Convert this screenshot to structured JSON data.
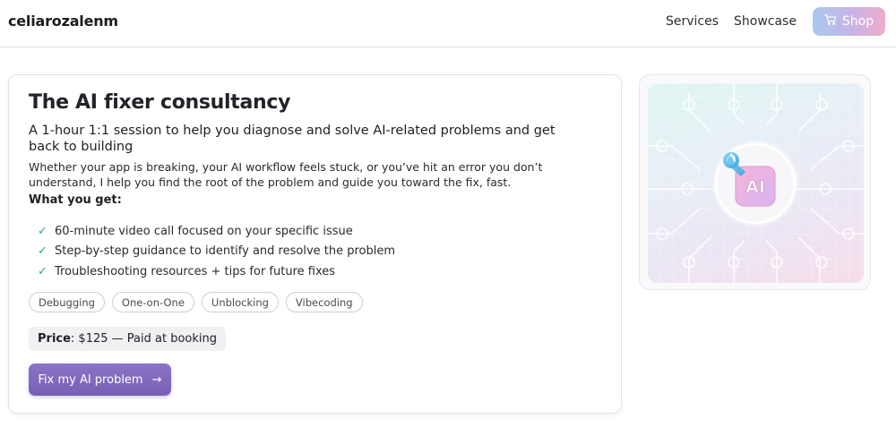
{
  "header": {
    "brand": "celiarozalenm",
    "nav": {
      "services": "Services",
      "showcase": "Showcase"
    },
    "shop_label": "Shop",
    "shop_icon": "cart-icon"
  },
  "card": {
    "title": "The AI fixer consultancy",
    "subtitle": "A 1-hour 1:1 session to help you diagnose and solve AI-related problems and get back to building",
    "description": "Whether your app is breaking, your AI workflow feels stuck, or you’ve hit an error you don’t understand, I help you find the root of the problem and guide you toward the fix, fast.",
    "what_heading": "What you get:",
    "benefits": [
      "60-minute video call focused on your specific issue",
      "Step-by-step guidance to identify and resolve the problem",
      "Troubleshooting resources + tips for future fixes"
    ],
    "check_glyph": "✓",
    "tags": [
      "Debugging",
      "One-on-One",
      "Unblocking",
      "Vibecoding"
    ],
    "price_label": "Price",
    "price_value": ": $125 — Paid at booking",
    "cta_label": "Fix my AI problem",
    "cta_arrow": "→"
  },
  "illustration": {
    "badge_text": "AI",
    "icon": "wrench-icon"
  },
  "colors": {
    "check": "#24a889",
    "cta": "#7c66bb",
    "shop_gradient": [
      "#a9c9ee",
      "#c7b4e6",
      "#efaccb"
    ]
  }
}
